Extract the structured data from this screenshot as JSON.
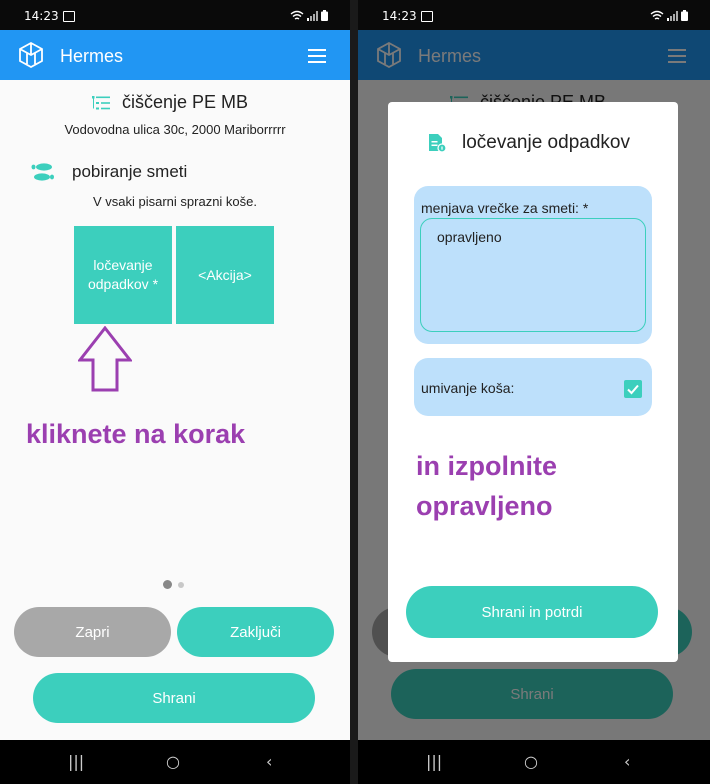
{
  "status": {
    "time": "14:23"
  },
  "app": {
    "title": "Hermes"
  },
  "task": {
    "title": "čiščenje PE MB",
    "address": "Vodovodna ulica 30c, 2000 Mariborrrrr"
  },
  "step": {
    "title": "pobiranje smeti",
    "description": "V vsaki pisarni sprazni koše."
  },
  "tiles": [
    {
      "label": "ločevanje odpadkov *"
    },
    {
      "label": "<Akcija>"
    }
  ],
  "annotations": {
    "left": "kliknete na korak",
    "right_line1": "in izpolnite",
    "right_line2": "opravljeno"
  },
  "buttons": {
    "close": "Zapri",
    "finish": "Zaključi",
    "save": "Shrani"
  },
  "dialog": {
    "title": "ločevanje odpadkov",
    "field1_label": "menjava vrečke za smeti: *",
    "field1_value": "opravljeno",
    "field2_label": "umivanje koša:",
    "field2_checked": true,
    "submit": "Shrani in potrdi"
  },
  "colors": {
    "accent": "#3ccfbd",
    "appbar": "#2196f3",
    "annotation": "#9b3fb0",
    "field_bg": "#bde0fb"
  }
}
